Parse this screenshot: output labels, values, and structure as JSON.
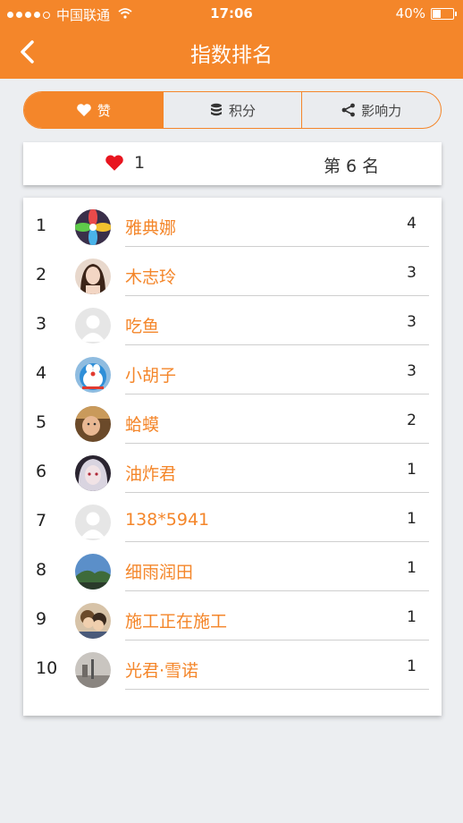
{
  "status": {
    "carrier": "中国联通",
    "time": "17:06",
    "battery": "40%",
    "battery_level": 0.4
  },
  "header": {
    "title": "指数排名"
  },
  "tabs": [
    {
      "label": "赞",
      "icon": "heart-icon",
      "active": true
    },
    {
      "label": "积分",
      "icon": "database-icon",
      "active": false
    },
    {
      "label": "影响力",
      "icon": "share-icon",
      "active": false
    }
  ],
  "mine": {
    "likes": "1",
    "rank": "第 6 名"
  },
  "ranking": [
    {
      "rank": "1",
      "name": "雅典娜",
      "score": "4",
      "avatar": "flower-avatar"
    },
    {
      "rank": "2",
      "name": "木志玲",
      "score": "3",
      "avatar": "woman-photo-avatar"
    },
    {
      "rank": "3",
      "name": "吃鱼",
      "score": "3",
      "avatar": "default-avatar"
    },
    {
      "rank": "4",
      "name": "小胡子",
      "score": "3",
      "avatar": "doraemon-avatar"
    },
    {
      "rank": "5",
      "name": "蛤蟆",
      "score": "2",
      "avatar": "child-photo-avatar"
    },
    {
      "rank": "6",
      "name": "油炸君",
      "score": "1",
      "avatar": "anime-avatar"
    },
    {
      "rank": "7",
      "name": "138*5941",
      "score": "1",
      "avatar": "default-avatar"
    },
    {
      "rank": "8",
      "name": "细雨润田",
      "score": "1",
      "avatar": "landscape-avatar"
    },
    {
      "rank": "9",
      "name": "施工正在施工",
      "score": "1",
      "avatar": "cartoon-couple-avatar"
    },
    {
      "rank": "10",
      "name": "光君·雪诺",
      "score": "1",
      "avatar": "street-photo-avatar"
    }
  ],
  "colors": {
    "accent": "#f4862a",
    "heart": "#e8151f",
    "background": "#eceef1"
  }
}
